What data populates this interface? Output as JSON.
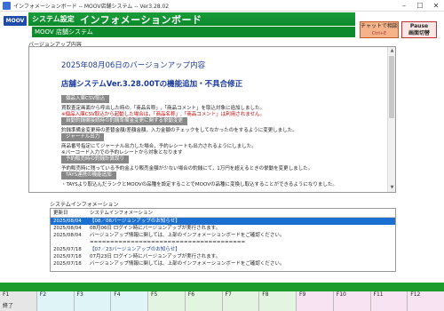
{
  "window": {
    "title": "インフォメーションボード -- MOOV店舗システム -- Ver3.28.02",
    "controls": [
      "–",
      "☐",
      "✕"
    ]
  },
  "header": {
    "logo": "MOOV",
    "system_settings": "システム設定",
    "page_title": "インフォメーションボード",
    "store_system": "MOOV 店舗システム",
    "chat_button": "チャットで相談",
    "chat_sub": "Ctrl+E",
    "pause_button": "Pause",
    "pause_sub": "画面切替"
  },
  "version_section": {
    "label": "バージョンアップ内容",
    "heading": "2025年08月06日のバージョンアップ内容",
    "subheading": "店舗システムVer.3.28.00Tの機能追加・不具合修正",
    "tag1": "個品入庫CSV取込",
    "line1": "買取査定画面から呼出した時の,「商品名称」,「商品コメント」を取込対象に追加しました。",
    "line2": "※個品入庫CSV取込から起動した場合は，「商品名称」,「商品コメント」は利用されません。",
    "tag2": "自動釣銭機接続時の釣銭準備金変更に関する挙動変更",
    "line3": "釣銭準備金変更時の差替金額/差額金額，入力金額のチェックをしてなかったのをするように変更しました。",
    "tag3": "ジャーナル出力",
    "line4": "商品番号指定にてジャーナル出力した場合，予約レシートも出力されるようにしました。",
    "line5": "※バーコード入力での予約レシートから対象となります",
    "tag4": "予約販売時の釣銭計算誤り",
    "line6": "予約販売時に残っている予約金より販売金額が少ない場合の釣銭にて，1万円を超えるときの挙動を変更しました。",
    "tag5": "TAYS連携の機能追加",
    "line7": "・TAYSより取込んだランクとMOOVの品種を設定することでMOOVの品種に変換し取込することができるようになりました。"
  },
  "info_section": {
    "label": "システムインフォメーション",
    "col_date": "更新日",
    "col_info": "システムインフォメーション",
    "rows": [
      {
        "date": "2025/08/04",
        "text": "【08／06バージョンアップのお知らせ】"
      },
      {
        "date": "2025/08/04",
        "text": "08月06日 ログイン時にバージョンアップが実行されます。"
      },
      {
        "date": "2025/08/04",
        "text": "バージョンアップ情報に関しては、上部のインフォメーションボードをご確認ください。"
      },
      {
        "date": "",
        "text": "======================================"
      },
      {
        "date": "2025/07/18",
        "text": "【07／23バージョンアップのお知らせ】"
      },
      {
        "date": "2025/07/18",
        "text": "07月23日 ログイン時にバージョンアップが実行されます。"
      },
      {
        "date": "2025/07/18",
        "text": "バージョンアップ情報に関しては、上部のインフォメーションボードをご確認ください。"
      }
    ]
  },
  "fkeys": [
    {
      "key": "F1",
      "label": "終了"
    },
    {
      "key": "F2",
      "label": ""
    },
    {
      "key": "F3",
      "label": ""
    },
    {
      "key": "F4",
      "label": ""
    },
    {
      "key": "F5",
      "label": ""
    },
    {
      "key": "F6",
      "label": ""
    },
    {
      "key": "F7",
      "label": ""
    },
    {
      "key": "F8",
      "label": ""
    },
    {
      "key": "F9",
      "label": ""
    },
    {
      "key": "F10",
      "label": ""
    },
    {
      "key": "F11",
      "label": ""
    },
    {
      "key": "F12",
      "label": ""
    }
  ],
  "colors": {
    "header_green": "#0c8a2c",
    "fkey_bar_green": "#1c9c2a",
    "highlight_blue": "#1a6fd0",
    "heading_blue": "#1a3a9c"
  }
}
